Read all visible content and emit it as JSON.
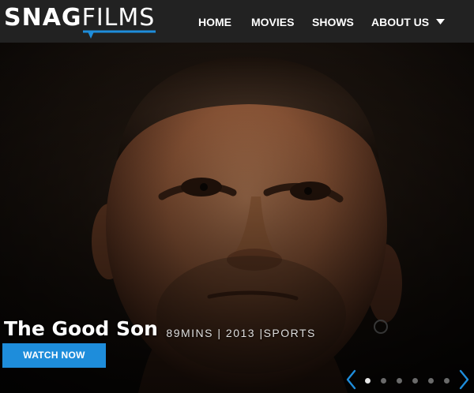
{
  "header": {
    "logo": {
      "part1": "SNAG",
      "part2": "FILMS"
    },
    "nav": [
      {
        "label": "HOME"
      },
      {
        "label": "MOVIES"
      },
      {
        "label": "SHOWS"
      },
      {
        "label": "ABOUT US",
        "has_dropdown": true
      }
    ]
  },
  "hero": {
    "title": "The Good Son",
    "meta": "89MINS | 2013 |SPORTS",
    "cta_label": "WATCH NOW",
    "carousel": {
      "slide_count": 6,
      "active_index": 0
    }
  },
  "colors": {
    "header_bg": "#222222",
    "accent": "#1E8DDB"
  },
  "icons": [
    "caret-down-icon",
    "chevron-left-icon",
    "chevron-right-icon"
  ]
}
